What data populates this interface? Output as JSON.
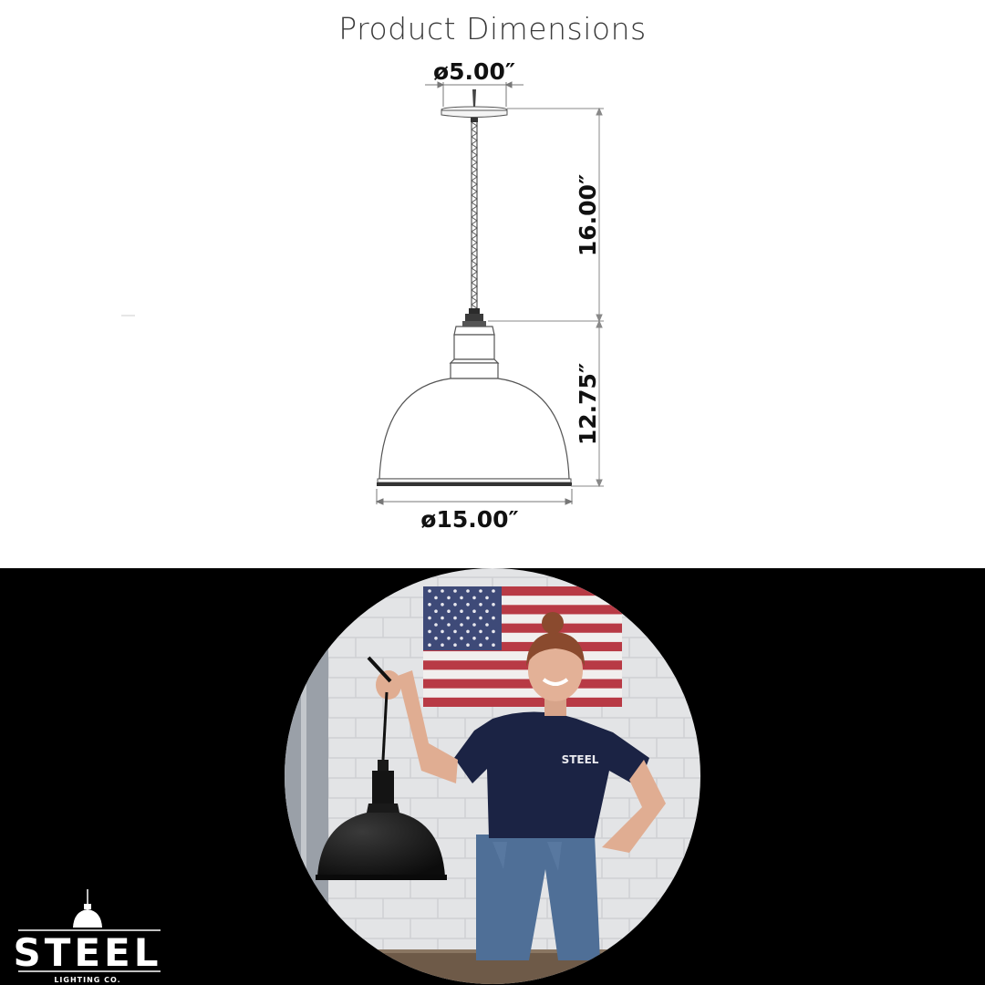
{
  "title": "Product Dimensions",
  "dimensions": {
    "canopy_diameter": "ø5.00″",
    "cord_length": "16.00″",
    "shade_height": "12.75″",
    "shade_diameter": "ø15.00″"
  },
  "logo": {
    "name": "STEEL",
    "subtitle": "LIGHTING CO."
  },
  "shirt_text": "STEEL",
  "colors": {
    "background_top": "#ffffff",
    "background_bottom": "#000000",
    "shade_black": "#141414",
    "shirt_navy": "#1b2344",
    "wall_white": "#e6e6e6"
  }
}
